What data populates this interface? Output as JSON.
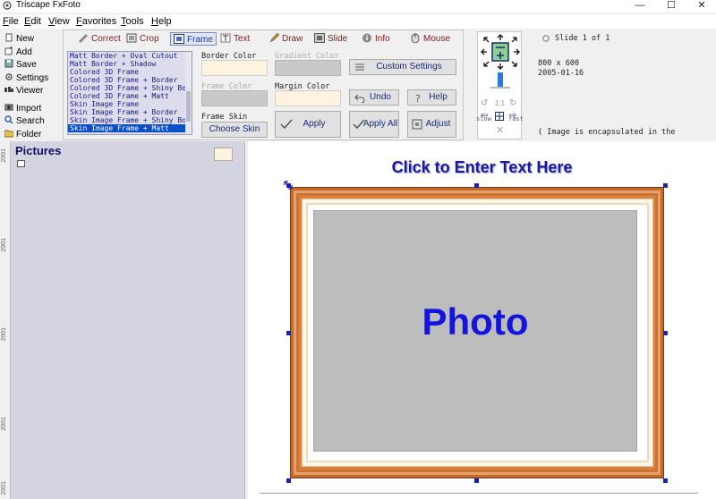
{
  "window": {
    "title": "Triscape FxFoto",
    "controls": {
      "minimize": "—",
      "maximize": "☐",
      "close": "✕"
    }
  },
  "menu": [
    "File",
    "Edit",
    "View",
    "Favorites",
    "Tools",
    "Help"
  ],
  "left_buttons": [
    "New",
    "Add",
    "Save",
    "Settings",
    "Viewer",
    "Import",
    "Search",
    "Folder"
  ],
  "tabs": [
    "Correct",
    "Crop",
    "Frame",
    "Text",
    "Draw",
    "Slide",
    "Info",
    "Mouse"
  ],
  "active_tab": "Frame",
  "frame_list": {
    "items": [
      "Matt Border + Oval Cutout",
      "Matt Border + Shadow",
      "Colored 3D Frame",
      "Colored 3D Frame + Border",
      "Colored 3D Frame + Shiny Bo",
      "Colored 3D Frame + Matt",
      "Skin Image Frame",
      "Skin Image Frame + Border",
      "Skin Image Frame + Shiny Bo",
      "Skin Image Frame + Matt"
    ],
    "selected": "Skin Image Frame + Matt"
  },
  "frame_options": {
    "border_color": "Border Color",
    "gradient_color": "Gradient Color",
    "frame_color": "Frame Color",
    "margin_color": "Margin Color",
    "frame_skin": "Frame Skin",
    "choose_skin": "Choose Skin",
    "custom_settings": "Custom Settings",
    "undo": "Undo",
    "help": "Help",
    "apply": "Apply",
    "apply_all": "Apply All",
    "adjust": "Adjust"
  },
  "navigator": {
    "slow": "slow",
    "fast": "fast",
    "one_to_one": "1:1"
  },
  "status": {
    "slide": "Slide 1 of 1",
    "dimensions": "800 x 600",
    "date": "2005-01-16",
    "note": "( Image is encapsulated in the"
  },
  "side_panel": {
    "title": "Pictures"
  },
  "canvas": {
    "text_placeholder": "Click to Enter Text Here",
    "photo_label": "Photo"
  },
  "ruler": {
    "labels": [
      "2001",
      "2001",
      "2001",
      "2001",
      "2001"
    ]
  },
  "colors": {
    "accent_blue": "#1414e0",
    "frame_orange": "#d9833f",
    "selection": "#0a4fc9",
    "panel_lavender": "#d4d3e0"
  }
}
